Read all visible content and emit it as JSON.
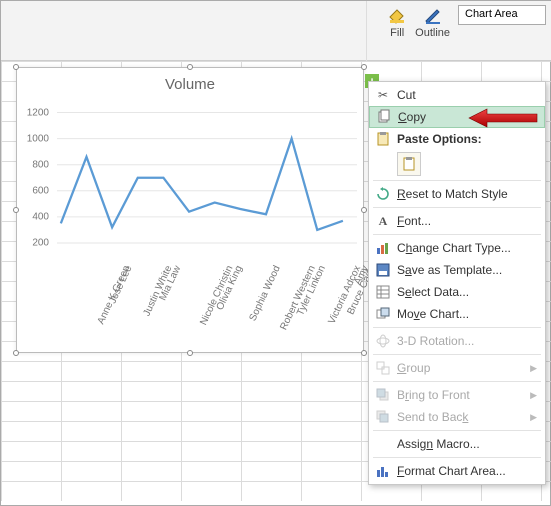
{
  "ribbon": {
    "fill_label": "Fill",
    "outline_label": "Outline",
    "chart_area_label": "Chart Area"
  },
  "chart_data": {
    "type": "line",
    "title": "Volume",
    "categories": [
      "Anne K Green",
      "Jose Lee",
      "Justin White",
      "Mia Law",
      "Nicole Christin",
      "Olivia King",
      "Sophia Wood",
      "Robert Western",
      "Tyler Linkon",
      "Victoria Adcox",
      "Bruce Cade",
      "Amy"
    ],
    "values": [
      350,
      860,
      320,
      700,
      700,
      440,
      510,
      460,
      420,
      1000,
      300,
      370
    ],
    "y_ticks": [
      200,
      400,
      600,
      800,
      1000,
      1200
    ],
    "ylim": [
      100,
      1250
    ]
  },
  "context_menu": {
    "cut": "Cut",
    "copy": "Copy",
    "paste_options": "Paste Options:",
    "reset": "Reset to Match Style",
    "font": "Font...",
    "change_type": "Change Chart Type...",
    "save_template": "Save as Template...",
    "select_data": "Select Data...",
    "move_chart": "Move Chart...",
    "rotation": "3-D Rotation...",
    "group": "Group",
    "bring_front": "Bring to Front",
    "send_back": "Send to Back",
    "assign_macro": "Assign Macro...",
    "format_area": "Format Chart Area..."
  },
  "add_btn": "+"
}
